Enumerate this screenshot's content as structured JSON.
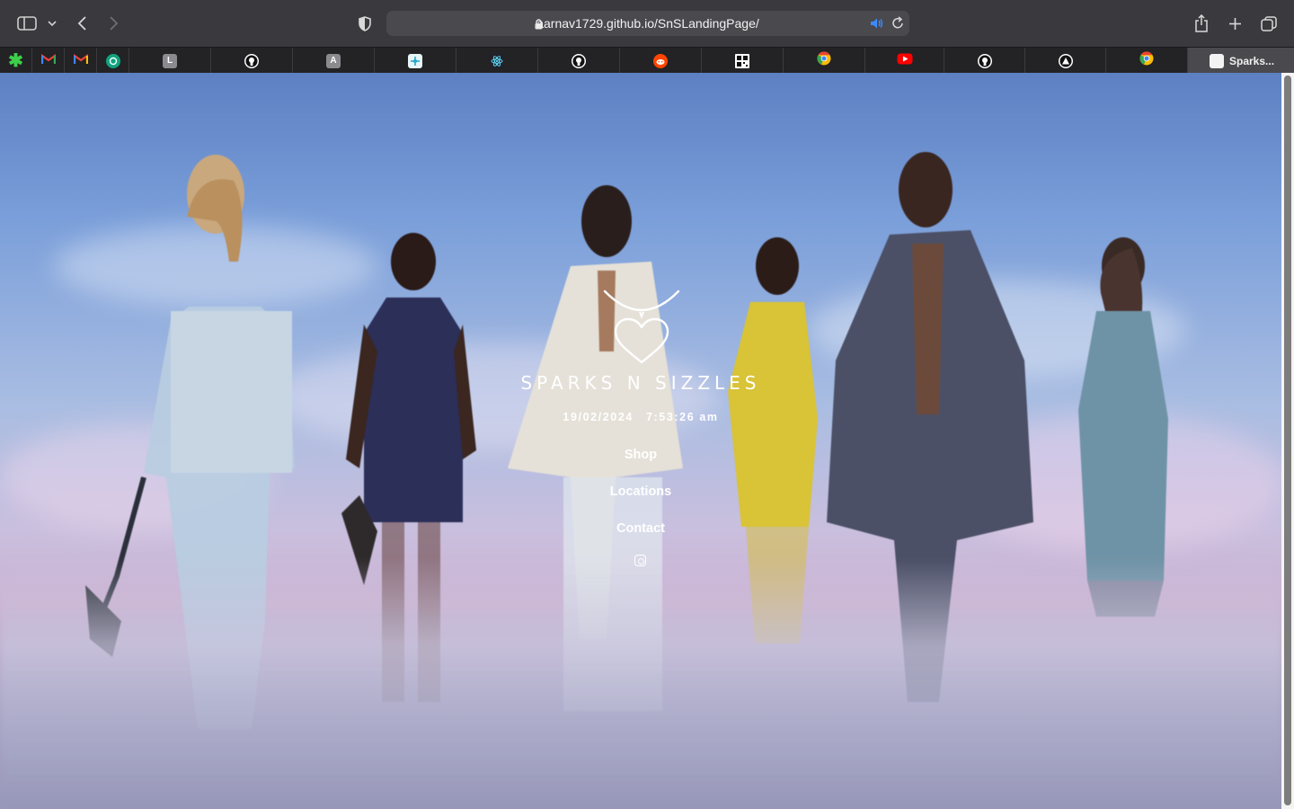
{
  "browser": {
    "url": "aarnav1729.github.io/SnSLandingPage/",
    "active_tab_title": "Sparks...",
    "tab_favicons": [
      "asterisk-icon",
      "gmail-icon",
      "gmail-icon",
      "chatgpt-icon",
      "letter-l-icon",
      "github-icon",
      "letter-a-icon",
      "figma-icon",
      "react-icon",
      "github-icon",
      "reddit-icon",
      "qr-icon",
      "chrome-icon",
      "youtube-icon",
      "github-icon",
      "triangle-icon",
      "chrome-icon"
    ],
    "favicon_letters": {
      "letter_l": "L",
      "letter_a": "A"
    }
  },
  "hero": {
    "brand": "SPARKS N SIZZLES",
    "date": "19/02/2024",
    "time": "7:53:26 am",
    "nav": {
      "shop": "Shop",
      "locations": "Locations",
      "contact": "Contact"
    },
    "social_icon": "instagram-icon"
  },
  "colors": {
    "sky_top": "#5c80c2",
    "sky_mid": "#a9bde2",
    "haze": "#cdb2d3",
    "text": "#ffffff",
    "toolbar": "#3a393d",
    "tabbar": "#232225"
  }
}
